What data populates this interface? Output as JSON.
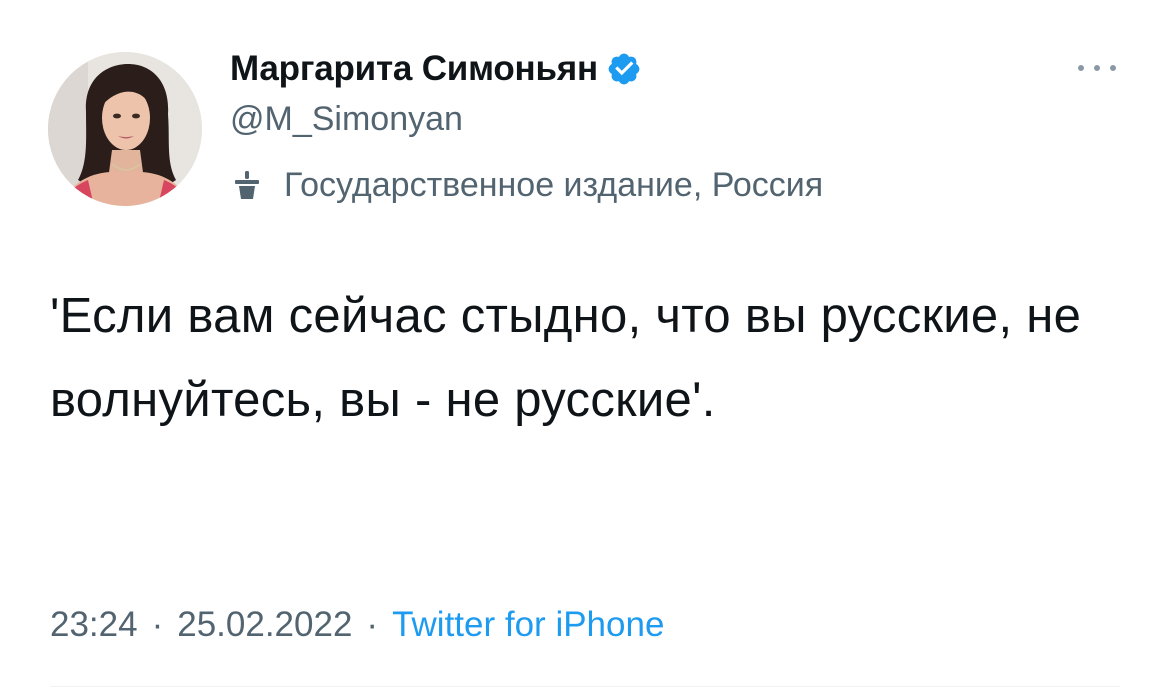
{
  "tweet": {
    "author": {
      "display_name": "Маргарита Симоньян",
      "handle": "@M_Simonyan",
      "verified": true,
      "verified_icon": "verified-badge-icon",
      "avatar_icon": "profile-photo"
    },
    "label": {
      "icon": "podium-icon",
      "text": "Государственное издание, Россия"
    },
    "more_icon": "more-options-icon",
    "text": "'Если вам сейчас стыдно, что вы русские, не волнуйтесь, вы - не русские'.",
    "meta": {
      "time": "23:24",
      "separator": "·",
      "date": "25.02.2022",
      "source": "Twitter for iPhone"
    }
  },
  "colors": {
    "accent": "#1d9bf0",
    "secondary_text": "#536471",
    "primary_text": "#0f1419",
    "background": "#ffffff"
  }
}
